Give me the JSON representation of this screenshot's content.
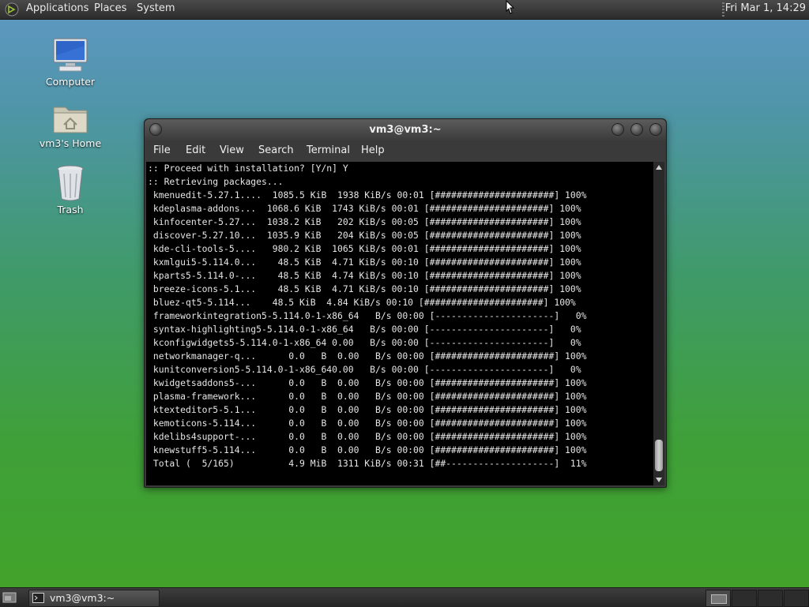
{
  "top_panel": {
    "menus": {
      "applications": "Applications",
      "places": "Places",
      "system": "System"
    },
    "clock": "Fri Mar  1, 14:29"
  },
  "desktop": {
    "icons": [
      {
        "label": "Computer",
        "icon": "computer-icon"
      },
      {
        "label": "vm3's Home",
        "icon": "home-folder-icon"
      },
      {
        "label": "Trash",
        "icon": "trash-icon"
      }
    ]
  },
  "terminal": {
    "title": "vm3@vm3:~",
    "menu": [
      "File",
      "Edit",
      "View",
      "Search",
      "Terminal",
      "Help"
    ],
    "lines": [
      ":: Proceed with installation? [Y/n] Y",
      ":: Retrieving packages...",
      " kmenuedit-5.27.1....  1085.5 KiB  1938 KiB/s 00:01 [######################] 100%",
      " kdeplasma-addons...  1068.6 KiB  1743 KiB/s 00:01 [######################] 100%",
      " kinfocenter-5.27...  1038.2 KiB   202 KiB/s 00:05 [######################] 100%",
      " discover-5.27.10...  1035.9 KiB   204 KiB/s 00:05 [######################] 100%",
      " kde-cli-tools-5....   980.2 KiB  1065 KiB/s 00:01 [######################] 100%",
      " kxmlgui5-5.114.0...    48.5 KiB  4.71 KiB/s 00:10 [######################] 100%",
      " kparts5-5.114.0-...    48.5 KiB  4.74 KiB/s 00:10 [######################] 100%",
      " breeze-icons-5.1...    48.5 KiB  4.71 KiB/s 00:10 [######################] 100%",
      " bluez-qt5-5.114...    48.5 KiB  4.84 KiB/s 00:10 [######################] 100%",
      " frameworkintegration5-5.114.0-1-x86_64   B/s 00:00 [----------------------]   0%",
      " syntax-highlighting5-5.114.0-1-x86_64   B/s 00:00 [----------------------]   0%",
      " kconfigwidgets5-5.114.0-1-x86_64 0.00   B/s 00:00 [----------------------]   0%",
      " networkmanager-q...      0.0   B  0.00   B/s 00:00 [######################] 100%",
      " kunitconversion5-5.114.0-1-x86_640.00   B/s 00:00 [----------------------]   0%",
      " kwidgetsaddons5-...      0.0   B  0.00   B/s 00:00 [######################] 100%",
      " plasma-framework...      0.0   B  0.00   B/s 00:00 [######################] 100%",
      " ktexteditor5-5.1...      0.0   B  0.00   B/s 00:00 [######################] 100%",
      " kemoticons-5.114...      0.0   B  0.00   B/s 00:00 [######################] 100%",
      " kdelibs4support-...      0.0   B  0.00   B/s 00:00 [######################] 100%",
      " knewstuff5-5.114...      0.0   B  0.00   B/s 00:00 [######################] 100%",
      " Total (  5/165)          4.9 MiB  1311 KiB/s 00:31 [##--------------------]  11%"
    ]
  },
  "bottom_panel": {
    "taskbar_item": "vm3@vm3:~",
    "workspaces": [
      "1",
      "2",
      "3",
      "4"
    ]
  }
}
